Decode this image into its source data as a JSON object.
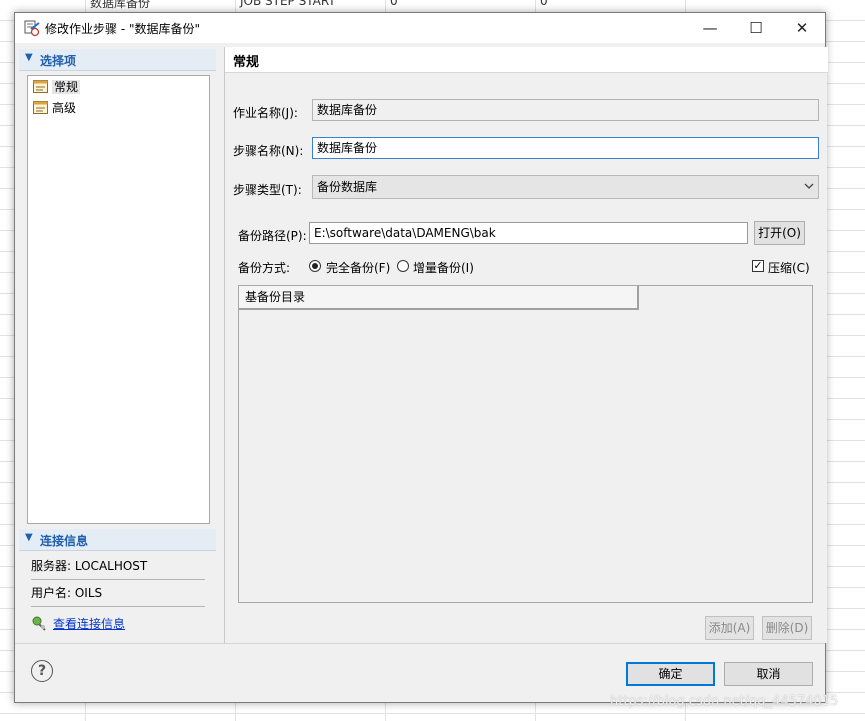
{
  "background": {
    "cells": [
      "数据库备份",
      "JOB STEP START",
      "0",
      "0"
    ],
    "watermark": "https://blog.csdn.net/qq_44574015"
  },
  "dialog": {
    "title": "修改作业步骤 - \"数据库备份\"",
    "window_controls": {
      "minimize": "—",
      "maximize": "☐",
      "close": "✕"
    },
    "left": {
      "options_header": "选择项",
      "tree_items": [
        {
          "label": "常规",
          "icon": "general-page-icon",
          "selected": true
        },
        {
          "label": "高级",
          "icon": "advanced-page-icon",
          "selected": false
        }
      ],
      "connection_header": "连接信息",
      "server": "服务器: LOCALHOST",
      "user": "用户名: OILS",
      "view_connection": "查看连接信息"
    },
    "main": {
      "section_title": "常规",
      "job_name_label": "作业名称(J):",
      "job_name_value": "数据库备份",
      "step_name_label": "步骤名称(N):",
      "step_name_value": "数据库备份",
      "step_type_label": "步骤类型(T):",
      "step_type_value": "备份数据库",
      "backup_path_label": "备份路径(P):",
      "backup_path_value": "E:\\software\\data\\DAMENG\\bak",
      "open_button": "打开(O)",
      "backup_mode_label": "备份方式:",
      "full_backup": "完全备份(F)",
      "incremental_backup": "增量备份(I)",
      "compress": "压缩(C)",
      "compress_checked": true,
      "full_selected": true,
      "base_dir_column": "基备份目录",
      "add_button": "添加(A)",
      "delete_button": "删除(D)"
    },
    "footer": {
      "help": "?",
      "ok": "确定",
      "cancel": "取消"
    }
  }
}
